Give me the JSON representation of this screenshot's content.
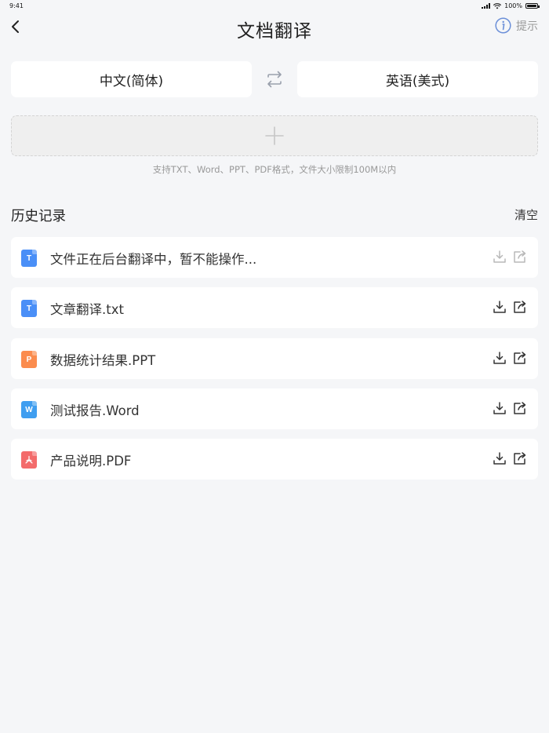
{
  "status_bar": {
    "time": "9:41",
    "battery": "100%"
  },
  "nav": {
    "title": "文档翻译",
    "tips_label": "提示"
  },
  "languages": {
    "source": "中文(简体)",
    "target": "英语(美式)"
  },
  "upload": {
    "hint": "支持TXT、Word、PPT、PDF格式，文件大小限制100M以内"
  },
  "history": {
    "title": "历史记录",
    "clear_label": "清空",
    "items": [
      {
        "name": "文件正在后台翻译中，暂不能操作...",
        "type": "txt",
        "icon_letter": "T",
        "color": "#4a8ff7",
        "disabled": true
      },
      {
        "name": "文章翻译.txt",
        "type": "txt",
        "icon_letter": "T",
        "color": "#4a8ff7",
        "disabled": false
      },
      {
        "name": "数据统计结果.PPT",
        "type": "ppt",
        "icon_letter": "P",
        "color": "#fb8c4e",
        "disabled": false
      },
      {
        "name": "测试报告.Word",
        "type": "word",
        "icon_letter": "W",
        "color": "#3f9ef0",
        "disabled": false
      },
      {
        "name": "产品说明.PDF",
        "type": "pdf",
        "icon_letter": "",
        "color": "#f36b6b",
        "disabled": false
      }
    ]
  }
}
